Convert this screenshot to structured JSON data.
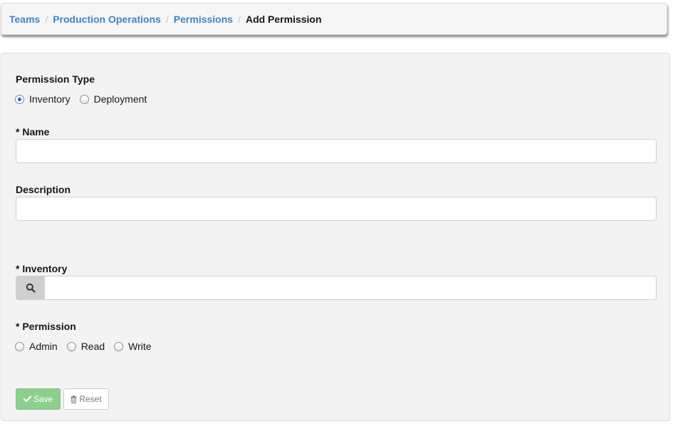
{
  "breadcrumb": {
    "items": [
      {
        "label": "Teams"
      },
      {
        "label": "Production Operations"
      },
      {
        "label": "Permissions"
      }
    ],
    "separator": "/",
    "current": "Add Permission"
  },
  "form": {
    "permission_type": {
      "label": "Permission Type",
      "options": [
        {
          "label": "Inventory",
          "selected": true
        },
        {
          "label": "Deployment",
          "selected": false
        }
      ]
    },
    "name": {
      "label": "* Name",
      "value": "",
      "placeholder": ""
    },
    "description": {
      "label": "Description",
      "value": "",
      "placeholder": ""
    },
    "inventory": {
      "label": "* Inventory",
      "value": "",
      "placeholder": "",
      "addon_icon": "search-icon"
    },
    "permission": {
      "label": "* Permission",
      "options": [
        {
          "label": "Admin",
          "selected": false
        },
        {
          "label": "Read",
          "selected": false
        },
        {
          "label": "Write",
          "selected": false
        }
      ]
    },
    "buttons": {
      "save_label": "Save",
      "save_icon": "check-icon",
      "reset_label": "Reset",
      "reset_icon": "trash-icon"
    }
  },
  "colors": {
    "link": "#3a87c7",
    "save_button": "#8ecf8e",
    "panel_bg": "#f3f3f3"
  }
}
